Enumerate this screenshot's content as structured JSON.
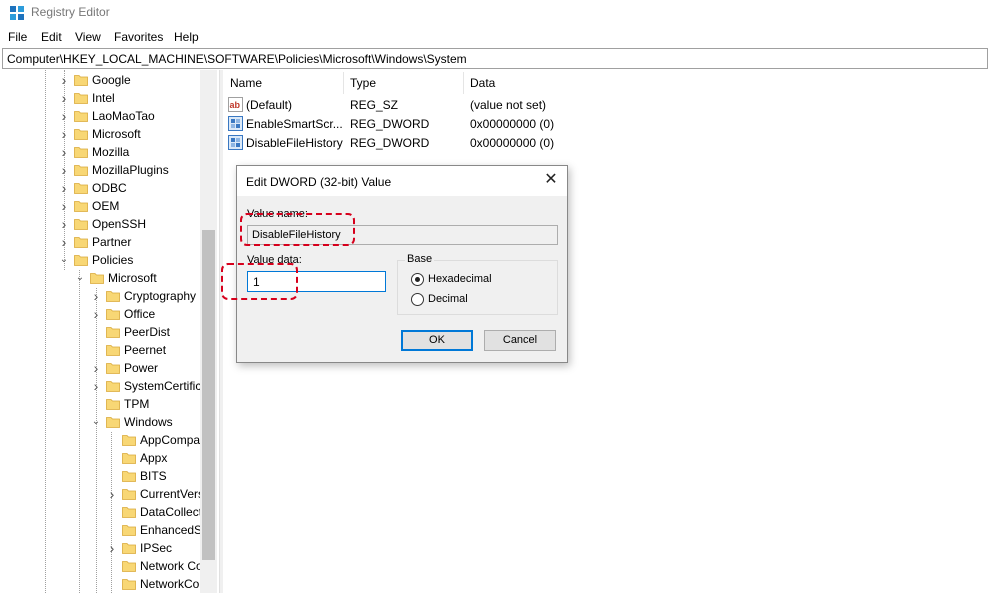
{
  "window": {
    "title": "Registry Editor",
    "icon": "registry-editor-icon"
  },
  "menu": [
    "File",
    "Edit",
    "View",
    "Favorites",
    "Help"
  ],
  "address": "Computer\\HKEY_LOCAL_MACHINE\\SOFTWARE\\Policies\\Microsoft\\Windows\\System",
  "tree": [
    {
      "label": "Google",
      "level": 0,
      "expander": "collapsed"
    },
    {
      "label": "Intel",
      "level": 0,
      "expander": "collapsed"
    },
    {
      "label": "LaoMaoTao",
      "level": 0,
      "expander": "collapsed"
    },
    {
      "label": "Microsoft",
      "level": 0,
      "expander": "collapsed"
    },
    {
      "label": "Mozilla",
      "level": 0,
      "expander": "collapsed"
    },
    {
      "label": "MozillaPlugins",
      "level": 0,
      "expander": "collapsed"
    },
    {
      "label": "ODBC",
      "level": 0,
      "expander": "collapsed"
    },
    {
      "label": "OEM",
      "level": 0,
      "expander": "collapsed"
    },
    {
      "label": "OpenSSH",
      "level": 0,
      "expander": "collapsed"
    },
    {
      "label": "Partner",
      "level": 0,
      "expander": "collapsed"
    },
    {
      "label": "Policies",
      "level": 0,
      "expander": "expanded"
    },
    {
      "label": "Microsoft",
      "level": 1,
      "expander": "expanded"
    },
    {
      "label": "Cryptography",
      "level": 2,
      "expander": "collapsed"
    },
    {
      "label": "Office",
      "level": 2,
      "expander": "collapsed"
    },
    {
      "label": "PeerDist",
      "level": 2,
      "expander": "none"
    },
    {
      "label": "Peernet",
      "level": 2,
      "expander": "none"
    },
    {
      "label": "Power",
      "level": 2,
      "expander": "collapsed"
    },
    {
      "label": "SystemCertific",
      "level": 2,
      "expander": "collapsed"
    },
    {
      "label": "TPM",
      "level": 2,
      "expander": "none"
    },
    {
      "label": "Windows",
      "level": 2,
      "expander": "expanded"
    },
    {
      "label": "AppCompa",
      "level": 3,
      "expander": "none"
    },
    {
      "label": "Appx",
      "level": 3,
      "expander": "none"
    },
    {
      "label": "BITS",
      "level": 3,
      "expander": "none"
    },
    {
      "label": "CurrentVers",
      "level": 3,
      "expander": "collapsed"
    },
    {
      "label": "DataCollect",
      "level": 3,
      "expander": "none"
    },
    {
      "label": "EnhancedS",
      "level": 3,
      "expander": "none"
    },
    {
      "label": "IPSec",
      "level": 3,
      "expander": "collapsed"
    },
    {
      "label": "Network Co",
      "level": 3,
      "expander": "none"
    },
    {
      "label": "NetworkCo",
      "level": 3,
      "expander": "none"
    }
  ],
  "columns": {
    "name": "Name",
    "type": "Type",
    "data": "Data"
  },
  "values": [
    {
      "icon": "string-value-icon",
      "name": "(Default)",
      "type": "REG_SZ",
      "data": "(value not set)"
    },
    {
      "icon": "dword-value-icon",
      "name": "EnableSmartScr...",
      "type": "REG_DWORD",
      "data": "0x00000000 (0)"
    },
    {
      "icon": "dword-value-icon",
      "name": "DisableFileHistory",
      "type": "REG_DWORD",
      "data": "0x00000000 (0)"
    }
  ],
  "dialog": {
    "title": "Edit DWORD (32-bit) Value",
    "value_name_label": "Value name:",
    "value_name": "DisableFileHistory",
    "value_data_label": "Value data:",
    "value_data": "1",
    "base_label": "Base",
    "hex_label": "Hexadecimal",
    "decimal_label": "Decimal",
    "selected_base": "Hexadecimal",
    "ok_label": "OK",
    "cancel_label": "Cancel"
  },
  "colors": {
    "highlight": "#d6001c",
    "accent": "#0078d7",
    "folder": "#f8d775"
  }
}
